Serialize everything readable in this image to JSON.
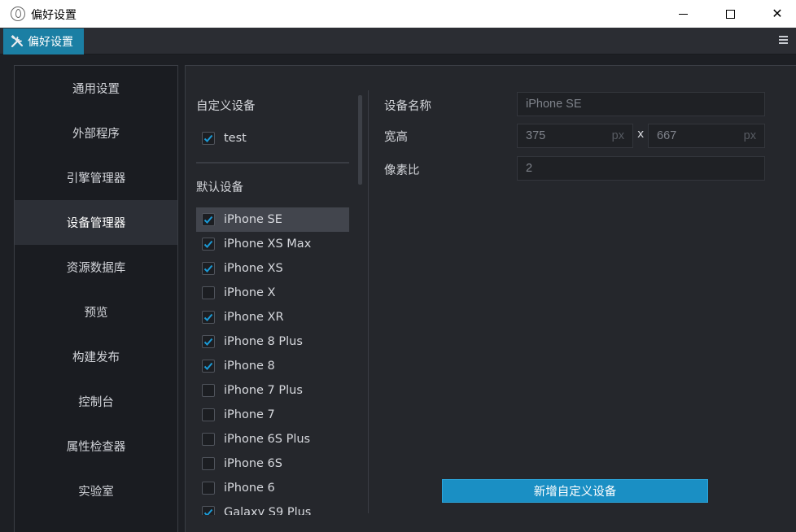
{
  "window": {
    "title": "偏好设置"
  },
  "tab": {
    "label": "偏好设置"
  },
  "sidebar": {
    "items": [
      {
        "label": "通用设置"
      },
      {
        "label": "外部程序"
      },
      {
        "label": "引擎管理器"
      },
      {
        "label": "设备管理器",
        "active": true
      },
      {
        "label": "资源数据库"
      },
      {
        "label": "预览"
      },
      {
        "label": "构建发布"
      },
      {
        "label": "控制台"
      },
      {
        "label": "属性检查器"
      },
      {
        "label": "实验室"
      }
    ]
  },
  "custom_devices": {
    "title": "自定义设备",
    "items": [
      {
        "label": "test",
        "checked": true
      }
    ]
  },
  "default_devices": {
    "title": "默认设备",
    "items": [
      {
        "label": "iPhone SE",
        "checked": true,
        "selected": true
      },
      {
        "label": "iPhone XS Max",
        "checked": true
      },
      {
        "label": "iPhone XS",
        "checked": true
      },
      {
        "label": "iPhone X",
        "checked": false
      },
      {
        "label": "iPhone XR",
        "checked": true
      },
      {
        "label": "iPhone 8 Plus",
        "checked": true
      },
      {
        "label": "iPhone 8",
        "checked": true
      },
      {
        "label": "iPhone 7 Plus",
        "checked": false
      },
      {
        "label": "iPhone 7",
        "checked": false
      },
      {
        "label": "iPhone 6S Plus",
        "checked": false
      },
      {
        "label": "iPhone 6S",
        "checked": false
      },
      {
        "label": "iPhone 6",
        "checked": false
      },
      {
        "label": "Galaxy S9 Plus",
        "checked": true
      }
    ]
  },
  "form": {
    "name_label": "设备名称",
    "name_value": "iPhone SE",
    "size_label": "宽高",
    "width_value": "375",
    "height_value": "667",
    "unit": "px",
    "size_separator": "x",
    "ratio_label": "像素比",
    "ratio_value": "2"
  },
  "add_button": {
    "label": "新增自定义设备"
  },
  "colors": {
    "accent": "#1a8fc4",
    "tab_active": "#1b7fa4",
    "check": "#1b9ad6"
  }
}
